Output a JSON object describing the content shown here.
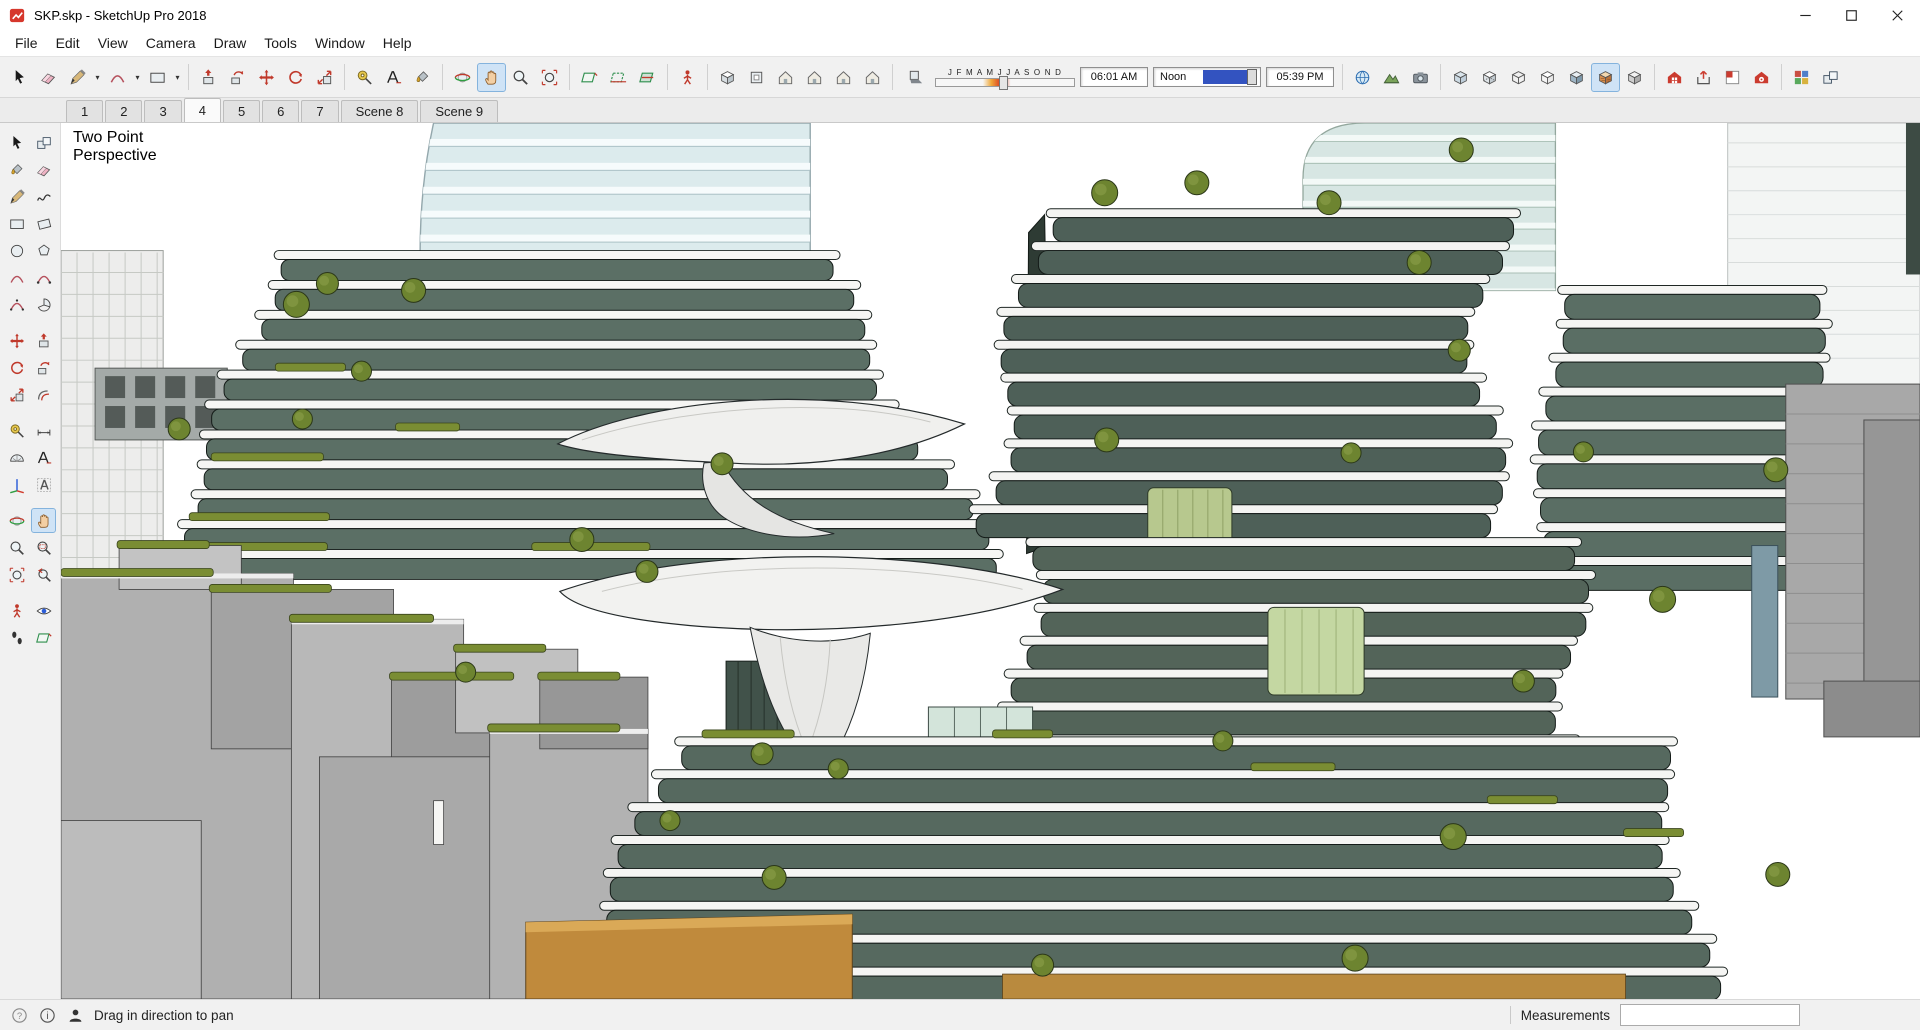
{
  "window": {
    "title": "SKP.skp - SketchUp Pro 2018"
  },
  "menu": {
    "items": [
      "File",
      "Edit",
      "View",
      "Camera",
      "Draw",
      "Tools",
      "Window",
      "Help"
    ]
  },
  "toolbar": {
    "groups": [
      {
        "buttons": [
          {
            "name": "select",
            "icon": "select"
          },
          {
            "name": "eraser",
            "icon": "eraser"
          },
          {
            "name": "line",
            "icon": "line",
            "dropdown": true
          },
          {
            "name": "arc",
            "icon": "arc",
            "dropdown": true
          },
          {
            "name": "rectangle",
            "icon": "rect",
            "dropdown": true
          }
        ]
      },
      {
        "buttons": [
          {
            "name": "push-pull",
            "icon": "pushpull"
          },
          {
            "name": "follow-me",
            "icon": "followme"
          },
          {
            "name": "move",
            "icon": "move"
          },
          {
            "name": "rotate",
            "icon": "rotate"
          },
          {
            "name": "scale",
            "icon": "scale"
          }
        ]
      },
      {
        "buttons": [
          {
            "name": "tape-measure",
            "icon": "tape"
          },
          {
            "name": "text",
            "icon": "text"
          },
          {
            "name": "paint-bucket",
            "icon": "paint"
          }
        ]
      },
      {
        "buttons": [
          {
            "name": "orbit",
            "icon": "orbit"
          },
          {
            "name": "pan",
            "icon": "pan",
            "active": true
          },
          {
            "name": "zoom",
            "icon": "zoom"
          },
          {
            "name": "zoom-extents",
            "icon": "zoomext"
          }
        ]
      },
      {
        "buttons": [
          {
            "name": "section-plane",
            "icon": "section"
          },
          {
            "name": "section-display",
            "icon": "sectiondisplay"
          },
          {
            "name": "section-cut",
            "icon": "sectioncut"
          }
        ]
      },
      {
        "buttons": [
          {
            "name": "position-camera",
            "icon": "poscamera"
          }
        ]
      },
      {
        "buttons": [
          {
            "name": "iso-view",
            "icon": "cubeview"
          },
          {
            "name": "top-view",
            "icon": "topview"
          },
          {
            "name": "front-view",
            "icon": "house"
          },
          {
            "name": "right-view",
            "icon": "house"
          },
          {
            "name": "back-view",
            "icon": "house"
          },
          {
            "name": "left-view",
            "icon": "house"
          }
        ]
      },
      {
        "type": "shadows"
      },
      {
        "buttons": [
          {
            "name": "add-location",
            "icon": "globe"
          },
          {
            "name": "toggle-terrain",
            "icon": "terrain"
          },
          {
            "name": "photo-textures",
            "icon": "camera"
          }
        ]
      },
      {
        "buttons": [
          {
            "name": "style-xray",
            "icon": "cube-xray"
          },
          {
            "name": "style-back-edges",
            "icon": "cube-backedges"
          },
          {
            "name": "style-wireframe",
            "icon": "cube-wire"
          },
          {
            "name": "style-hidden-line",
            "icon": "cube-hidden"
          },
          {
            "name": "style-shaded",
            "icon": "cube-shaded"
          },
          {
            "name": "style-shaded-textures",
            "icon": "cube-textured",
            "active": true
          },
          {
            "name": "style-monochrome",
            "icon": "cube-mono"
          }
        ]
      },
      {
        "buttons": [
          {
            "name": "3d-warehouse",
            "icon": "warehouse"
          },
          {
            "name": "share-model",
            "icon": "share"
          },
          {
            "name": "send-to-layout",
            "icon": "layout"
          },
          {
            "name": "extension-warehouse",
            "icon": "extwarehouse"
          }
        ]
      },
      {
        "buttons": [
          {
            "name": "materials-panel",
            "icon": "materials"
          },
          {
            "name": "components-panel",
            "icon": "components"
          }
        ]
      }
    ]
  },
  "shadows": {
    "months": "J F M A M J J A S O N D",
    "time_start": "06:01 AM",
    "noon_label": "Noon",
    "time_end": "05:39 PM"
  },
  "scene_tabs": {
    "tabs": [
      "1",
      "2",
      "3",
      "4",
      "5",
      "6",
      "7",
      "Scene 8",
      "Scene 9"
    ],
    "active_index": 3
  },
  "left_palette": {
    "rows": [
      [
        "select",
        "make-component"
      ],
      [
        "paint-bucket",
        "eraser"
      ],
      [
        "line",
        "freehand"
      ],
      [
        "rectangle",
        "rotated-rectangle"
      ],
      [
        "circle",
        "polygon"
      ],
      [
        "arc",
        "two-point-arc"
      ],
      [
        "three-point-arc",
        "pie"
      ],
      [
        "move",
        "push-pull"
      ],
      [
        "rotate",
        "follow-me"
      ],
      [
        "scale",
        "offset"
      ],
      [
        "tape-measure",
        "dimension"
      ],
      [
        "protractor",
        "text"
      ],
      [
        "axes",
        "3d-text"
      ],
      [
        "orbit",
        "pan"
      ],
      [
        "zoom",
        "zoom-window"
      ],
      [
        "zoom-extents",
        "zoom-previous"
      ],
      [
        "position-camera",
        "look-around"
      ],
      [
        "walk",
        "section-plane"
      ]
    ],
    "active": "pan"
  },
  "viewport": {
    "overlay_label": "Two Point\nPerspective"
  },
  "status_bar": {
    "hint": "Drag in direction to pan",
    "measurements_label": "Measurements",
    "measurements_value": ""
  },
  "colors": {
    "accent_active_bg": "#cfe3f6",
    "accent_active_border": "#84b3dd",
    "logo_red": "#d6372c",
    "tree_green": "#6d8430",
    "glass_teal": "#5b6f65"
  }
}
